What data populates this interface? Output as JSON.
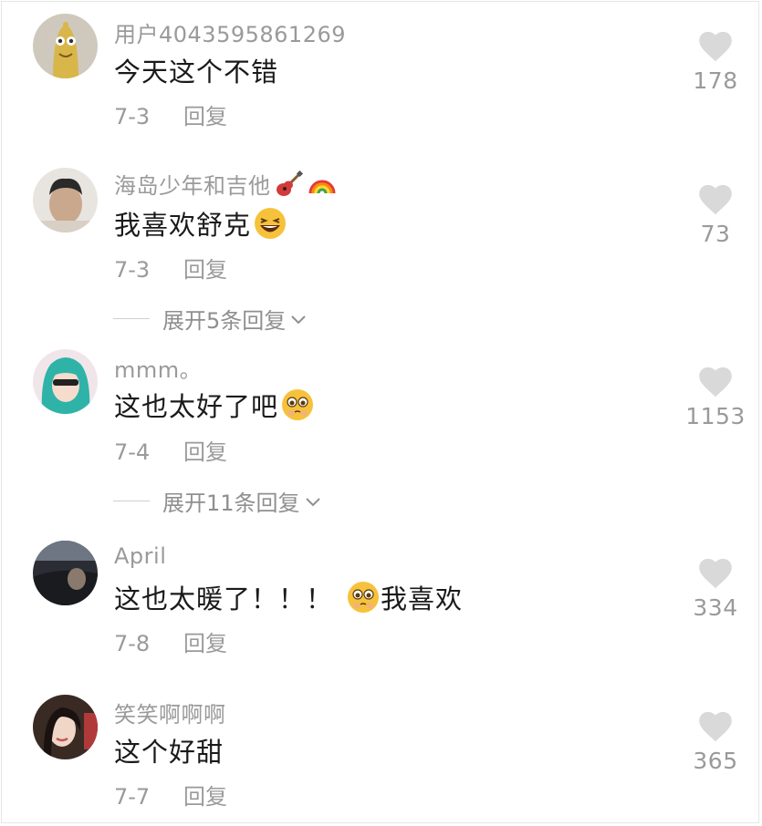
{
  "comments": [
    {
      "username": "用户4043595861269",
      "text": "今天这个不错",
      "date": "7-3",
      "reply_label": "回复",
      "likes": "178",
      "avatar_icon": "sausage-cartoon-avatar"
    },
    {
      "username": "海岛少年和吉他",
      "username_icons": [
        "guitar-icon",
        "rainbow-icon"
      ],
      "text": "我喜欢舒克",
      "text_emoji": "laughing-emoji",
      "date": "7-3",
      "reply_label": "回复",
      "likes": "73",
      "expand_label": "展开5条回复"
    },
    {
      "username": "mmm。",
      "text": "这也太好了吧",
      "text_emoji": "pleading-emoji",
      "date": "7-4",
      "reply_label": "回复",
      "likes": "1153",
      "expand_label": "展开11条回复"
    },
    {
      "username": "April",
      "text_before": "这也太暖了！！！",
      "text_emoji": "pleading-emoji",
      "text_after": "我喜欢",
      "date": "7-8",
      "reply_label": "回复",
      "likes": "334"
    },
    {
      "username": "笑笑啊啊啊",
      "text": "这个好甜",
      "date": "7-7",
      "reply_label": "回复",
      "likes": "365"
    }
  ],
  "colors": {
    "meta_gray": "#9a9a9a",
    "text_dark": "#1a1a1a",
    "heart_gray": "#d9d9d9"
  }
}
